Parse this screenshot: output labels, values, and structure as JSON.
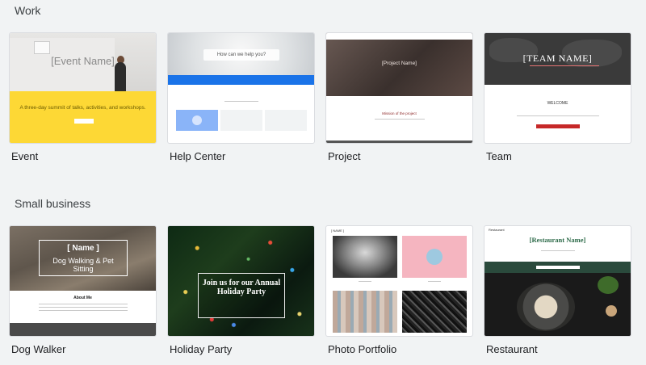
{
  "sections": {
    "work": {
      "title": "Work"
    },
    "small_business": {
      "title": "Small business"
    }
  },
  "templates": {
    "event": {
      "label": "Event",
      "preview_title": "[Event Name]",
      "preview_desc": "A three-day summit of talks, activities, and workshops."
    },
    "help_center": {
      "label": "Help Center",
      "preview_search": "How can we help you?"
    },
    "project": {
      "label": "Project",
      "preview_title": "[Project Name]",
      "preview_mission": "Mission of the project"
    },
    "team": {
      "label": "Team",
      "preview_title": "[TEAM NAME]",
      "preview_welcome": "WELCOME"
    },
    "dog_walker": {
      "label": "Dog Walker",
      "preview_name": "[ Name ]",
      "preview_sub": "Dog Walking & Pet Sitting",
      "preview_about": "About Me"
    },
    "holiday_party": {
      "label": "Holiday Party",
      "preview_title": "Join us for our Annual Holiday Party"
    },
    "photo_portfolio": {
      "label": "Photo Portfolio",
      "preview_name": "[ NAME ]"
    },
    "restaurant": {
      "label": "Restaurant",
      "preview_small": "Restaurant",
      "preview_title": "[Restaurant Name]"
    }
  },
  "colors": {
    "background": "#f1f3f4",
    "event_yellow": "#fdd835",
    "help_blue": "#1a73e8",
    "team_red": "#c62828",
    "restaurant_green": "#2a4a3c"
  }
}
